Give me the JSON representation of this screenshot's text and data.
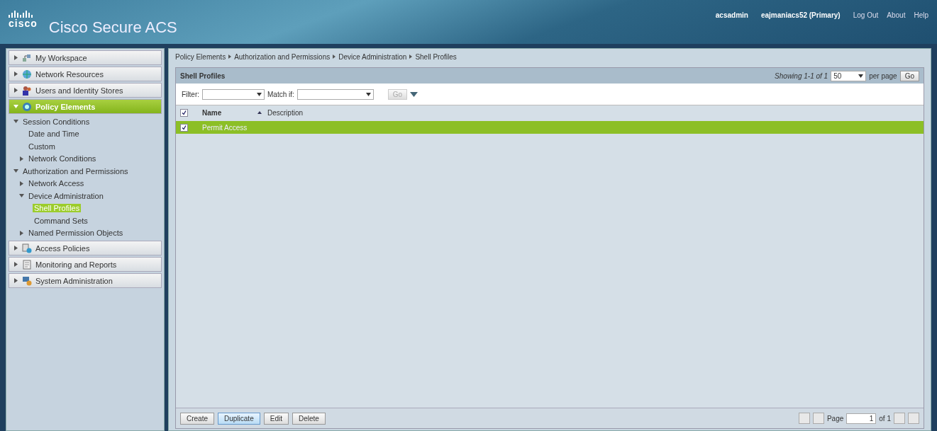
{
  "header": {
    "logo": "cisco",
    "title": "Cisco Secure ACS",
    "user": "acsadmin",
    "server": "eajmaniacs52 (Primary)",
    "links": [
      "Log Out",
      "About",
      "Help"
    ]
  },
  "nav": [
    {
      "label": "My Workspace",
      "kind": "workspace",
      "expanded": false,
      "selected": false
    },
    {
      "label": "Network Resources",
      "kind": "network",
      "expanded": false,
      "selected": false
    },
    {
      "label": "Users and Identity Stores",
      "kind": "users",
      "expanded": false,
      "selected": false
    },
    {
      "label": "Policy Elements",
      "kind": "policy",
      "expanded": true,
      "selected": true,
      "children": [
        {
          "label": "Session Conditions",
          "expanded": true,
          "selected": false,
          "children": [
            {
              "label": "Date and Time",
              "selected": false
            },
            {
              "label": "Custom",
              "selected": false
            },
            {
              "label": "Network Conditions",
              "expanded": false,
              "selected": false
            }
          ]
        },
        {
          "label": "Authorization and Permissions",
          "expanded": true,
          "selected": false,
          "children": [
            {
              "label": "Network Access",
              "expanded": false,
              "selected": false
            },
            {
              "label": "Device Administration",
              "expanded": true,
              "selected": false,
              "children": [
                {
                  "label": "Shell Profiles",
                  "selected": true
                },
                {
                  "label": "Command Sets",
                  "selected": false
                }
              ]
            },
            {
              "label": "Named Permission Objects",
              "expanded": false,
              "selected": false
            }
          ]
        }
      ]
    },
    {
      "label": "Access Policies",
      "kind": "access",
      "expanded": false,
      "selected": false
    },
    {
      "label": "Monitoring and Reports",
      "kind": "reports",
      "expanded": false,
      "selected": false
    },
    {
      "label": "System Administration",
      "kind": "system",
      "expanded": false,
      "selected": false
    }
  ],
  "breadcrumb": [
    "Policy Elements",
    "Authorization and Permissions",
    "Device Administration",
    "Shell Profiles"
  ],
  "panel": {
    "title": "Shell Profiles",
    "showing": "Showing 1-1 of 1",
    "per_page": "50",
    "per_page_label": "per page",
    "go": "Go"
  },
  "filter": {
    "label": "Filter:",
    "match_label": "Match if:",
    "go": "Go",
    "go_disabled": true
  },
  "table": {
    "header_checked": true,
    "columns": [
      {
        "label": "Name",
        "sorted": true
      },
      {
        "label": "Description",
        "sorted": false
      }
    ],
    "rows": [
      {
        "name": "Permit Access",
        "selected": true,
        "checked": true
      }
    ]
  },
  "footer": {
    "buttons": [
      {
        "label": "Create",
        "focused": false
      },
      {
        "label": "Duplicate",
        "focused": true
      },
      {
        "label": "Edit",
        "focused": false
      },
      {
        "label": "Delete",
        "focused": false
      }
    ],
    "page_label": "Page",
    "page": "1",
    "of": "of 1"
  }
}
